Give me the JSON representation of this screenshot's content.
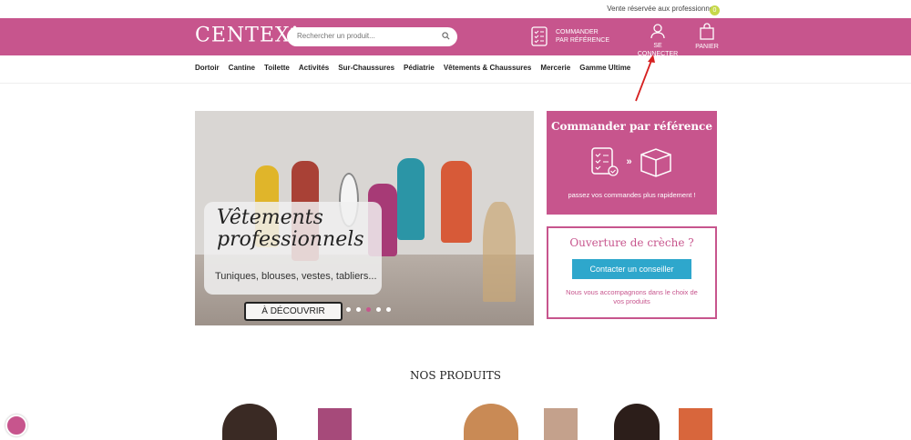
{
  "topbar": {
    "notice": "Vente réservée aux professionnels"
  },
  "header": {
    "logo": "CENTEX",
    "search_placeholder": "Rechercher un produit...",
    "order_label_1": "COMMANDER",
    "order_label_2": "PAR RÉFÉRENCE",
    "login_label": "SE CONNECTER",
    "cart_label": "PANIER",
    "cart_count": "0"
  },
  "nav": {
    "items": [
      "Dortoir",
      "Cantine",
      "Toilette",
      "Activités",
      "Sur-Chaussures",
      "Pédiatrie",
      "Vêtements & Chaussures",
      "Mercerie",
      "Gamme Ultime"
    ]
  },
  "hero": {
    "title_1": "Vêtements",
    "title_2": "professionnels",
    "subtitle": "Tuniques, blouses, vestes, tabliers...",
    "button": "À DÉCOUVRIR"
  },
  "order_card": {
    "title": "Commander par référence",
    "subtitle": "passez vos commandes plus rapidement !"
  },
  "creche_card": {
    "title": "Ouverture de crèche ?",
    "button": "Contacter un conseiller",
    "text": "Nous vous accompagnons dans le choix de vos produits"
  },
  "products": {
    "title": "NOS PRODUITS"
  },
  "colors": {
    "brand": "#c7558d",
    "contact": "#2ea7cc",
    "badge": "#c6d84a"
  }
}
